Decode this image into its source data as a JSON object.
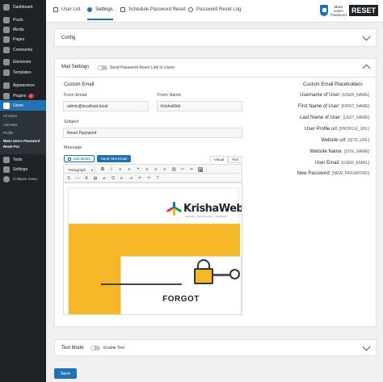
{
  "sidebar": {
    "items": [
      {
        "label": "Dashboard",
        "icon": "dashboard-icon"
      },
      {
        "label": "Posts",
        "icon": "pin-icon"
      },
      {
        "label": "Media",
        "icon": "media-icon"
      },
      {
        "label": "Pages",
        "icon": "page-icon"
      },
      {
        "label": "Comments",
        "icon": "comment-icon"
      },
      {
        "label": "Elementor",
        "icon": "elementor-icon"
      },
      {
        "label": "Templates",
        "icon": "folder-icon"
      },
      {
        "label": "Appearance",
        "icon": "brush-icon"
      },
      {
        "label": "Plugins",
        "icon": "plugin-icon",
        "badge": "2"
      },
      {
        "label": "Users",
        "icon": "users-icon"
      },
      {
        "label": "Tools",
        "icon": "wrench-icon"
      },
      {
        "label": "Settings",
        "icon": "settings-icon"
      },
      {
        "label": "Collapse menu",
        "icon": "collapse-icon"
      }
    ],
    "submenu": [
      "All Users",
      "Add New",
      "Profile",
      "Mass Users Password",
      "Reset Pro"
    ]
  },
  "tabs": {
    "user_list": "User List",
    "settings": "Settings",
    "schedule": "Schedule Password Reset",
    "log": "Password Reset Log"
  },
  "brand": {
    "line1": "Mass Users",
    "line2": "Password",
    "reset": "RESET"
  },
  "config": {
    "title": "Config"
  },
  "mail": {
    "title": "Mail Settings",
    "toggle_label": "Send Password Reset Link to Users",
    "custom_email": "Custom Email",
    "from_email_label": "From Email",
    "from_email_value": "admin@localhost.local",
    "from_name_label": "From Name",
    "from_name_value": "KrishaWeb",
    "subject_label": "Subject",
    "subject_value": "Reset Password",
    "message_label": "Message",
    "add_media": "Add Media",
    "send_test": "Send Test Email",
    "visual_tab": "Visual",
    "text_tab": "Text",
    "format_select": "Paragraph"
  },
  "email_preview": {
    "logo_text": "KrishaWeb",
    "tagline": "DESIGN | TECHNOLOGY | CREATIVE",
    "heading": "FORGOT"
  },
  "placeholders": {
    "title": "Custom Email Placeholders",
    "rows": [
      {
        "label": "Username of User:",
        "code": "[USER_NAME]"
      },
      {
        "label": "First Name of User:",
        "code": "[FIRST_NAME]"
      },
      {
        "label": "Last Name of User:",
        "code": "[LAST_NAME]"
      },
      {
        "label": "User Profile url:",
        "code": "[PROFILE_URL]"
      },
      {
        "label": "Website url:",
        "code": "[SITE_URL]"
      },
      {
        "label": "Website Name:",
        "code": "[SITE_NAME]"
      },
      {
        "label": "User Email:",
        "code": "[USER_EMAIL]"
      },
      {
        "label": "New Password:",
        "code": "[NEW_PASSWORD]"
      }
    ]
  },
  "test_mode": {
    "title": "Test Mode",
    "toggle_label": "Enable Test"
  },
  "save_label": "Save",
  "colors": {
    "accent": "#2271b1",
    "sidebar": "#1d2327",
    "email_yellow": "#f4b826"
  }
}
